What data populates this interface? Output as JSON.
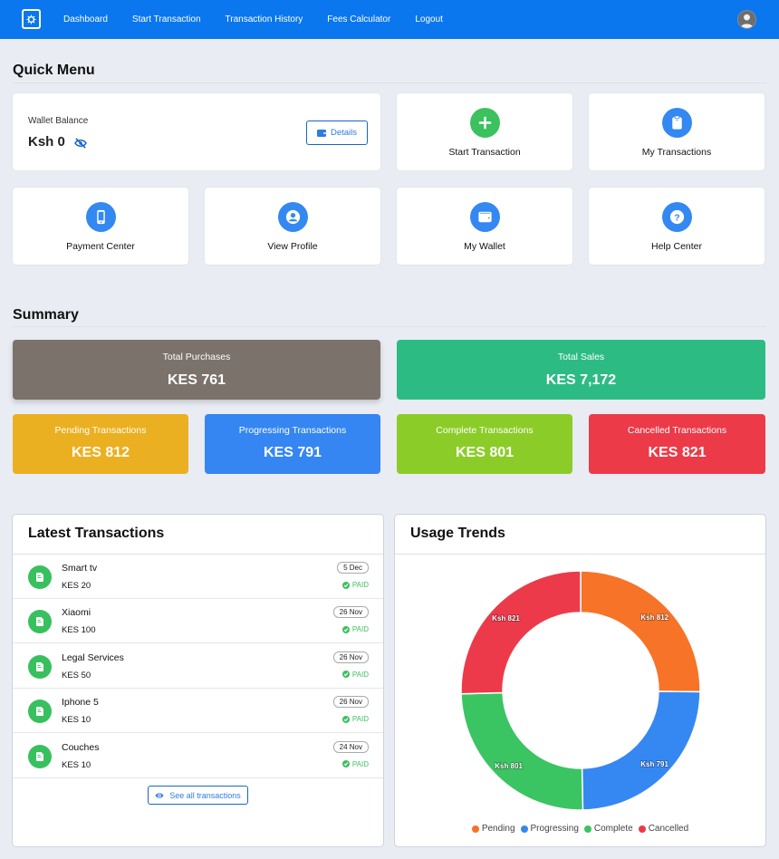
{
  "nav": {
    "logo_icon": "safe-icon",
    "links": [
      "Dashboard",
      "Start Transaction",
      "Transaction History",
      "Fees Calculator",
      "Logout"
    ],
    "avatar_icon": "user-avatar-icon",
    "color": "#0a77ee"
  },
  "quick_menu": {
    "title": "Quick Menu",
    "wallet": {
      "label": "Wallet Balance",
      "amount": "Ksh 0",
      "visibility_icon": "eye-off-icon",
      "details_label": "Details",
      "details_icon": "wallet-icon"
    },
    "tiles": [
      {
        "label": "Start Transaction",
        "icon": "plus-icon",
        "color": "#3bc15e"
      },
      {
        "label": "My Transactions",
        "icon": "clipboard-icon",
        "color": "#3388f2"
      },
      {
        "label": "Payment Center",
        "icon": "mobile-phone-icon",
        "color": "#3388f2"
      },
      {
        "label": "View Profile",
        "icon": "user-circle-icon",
        "color": "#3388f2"
      },
      {
        "label": "My Wallet",
        "icon": "wallet-icon",
        "color": "#3388f2"
      },
      {
        "label": "Help Center",
        "icon": "question-icon",
        "color": "#3388f2"
      }
    ]
  },
  "summary": {
    "title": "Summary",
    "stats": [
      {
        "label": "Total Purchases",
        "value": "KES 761",
        "color": "#7b726b"
      },
      {
        "label": "Total Sales",
        "value": "KES 7,172",
        "color": "#2dbb84"
      },
      {
        "label": "Pending Transactions",
        "value": "KES 812",
        "color": "#ebb021"
      },
      {
        "label": "Progressing Transactions",
        "value": "KES 791",
        "color": "#3586f2"
      },
      {
        "label": "Complete Transactions",
        "value": "KES 801",
        "color": "#8ccc28"
      },
      {
        "label": "Cancelled Transactions",
        "value": "KES 821",
        "color": "#ec3a48"
      }
    ]
  },
  "latest_transactions": {
    "title": "Latest Transactions",
    "items": [
      {
        "name": "Smart tv",
        "amount": "KES 20",
        "date": "5 Dec",
        "status": "PAID"
      },
      {
        "name": "Xiaomi",
        "amount": "KES 100",
        "date": "26 Nov",
        "status": "PAID"
      },
      {
        "name": "Legal Services",
        "amount": "KES 50",
        "date": "26 Nov",
        "status": "PAID"
      },
      {
        "name": "Iphone 5",
        "amount": "KES 10",
        "date": "26 Nov",
        "status": "PAID"
      },
      {
        "name": "Couches",
        "amount": "KES 10",
        "date": "24 Nov",
        "status": "PAID"
      }
    ],
    "see_all_label": "See all transactions"
  },
  "usage_trends": {
    "title": "Usage Trends"
  },
  "chart_data": {
    "type": "pie",
    "variant": "doughnut",
    "title": "Usage Trends",
    "categories": [
      "Pending",
      "Progressing",
      "Complete",
      "Cancelled"
    ],
    "values": [
      812,
      791,
      801,
      821
    ],
    "data_labels": [
      "Ksh 812",
      "Ksh 791",
      "Ksh 801",
      "Ksh 821"
    ],
    "colors": [
      "#f67327",
      "#3588f2",
      "#3bc462",
      "#ec3a4a"
    ],
    "legend": {
      "position": "bottom",
      "entries": [
        "Pending",
        "Progressing",
        "Complete",
        "Cancelled"
      ]
    }
  }
}
